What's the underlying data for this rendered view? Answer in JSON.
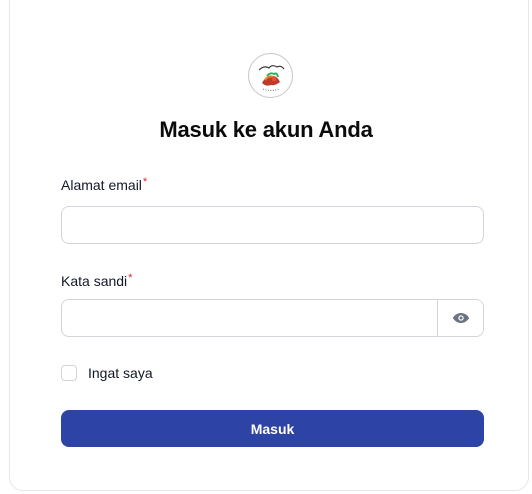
{
  "colors": {
    "accent": "#2e43a6",
    "required": "#dc2626",
    "border": "#d1d5db"
  },
  "logo": {
    "icon": "brand-logo-icon"
  },
  "title": "Masuk ke akun Anda",
  "email": {
    "label": "Alamat email",
    "required_mark": "*",
    "value": "",
    "placeholder": ""
  },
  "password": {
    "label": "Kata sandi",
    "required_mark": "*",
    "value": "",
    "placeholder": "",
    "toggle_icon": "eye-icon"
  },
  "remember": {
    "label": "Ingat saya",
    "checked": false
  },
  "submit": {
    "label": "Masuk"
  }
}
